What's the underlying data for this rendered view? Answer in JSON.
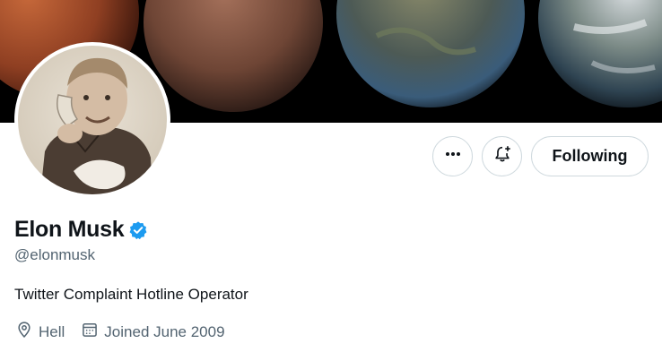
{
  "header": {
    "banner_image": "mars-terraforming-banner",
    "avatar_image": "child-with-telephone-photo"
  },
  "actions": {
    "more_icon": "more-icon",
    "notify_icon": "bell-plus-icon",
    "following_label": "Following"
  },
  "profile": {
    "display_name": "Elon Musk",
    "verified_icon": "verified-badge-icon",
    "handle": "@elonmusk",
    "bio": "Twitter Complaint Hotline Operator",
    "location": "Hell",
    "joined": "Joined June 2009"
  },
  "colors": {
    "primary_text": "#0f1419",
    "secondary_text": "#536471",
    "border": "#cfd9de",
    "verified": "#1d9bf0"
  }
}
